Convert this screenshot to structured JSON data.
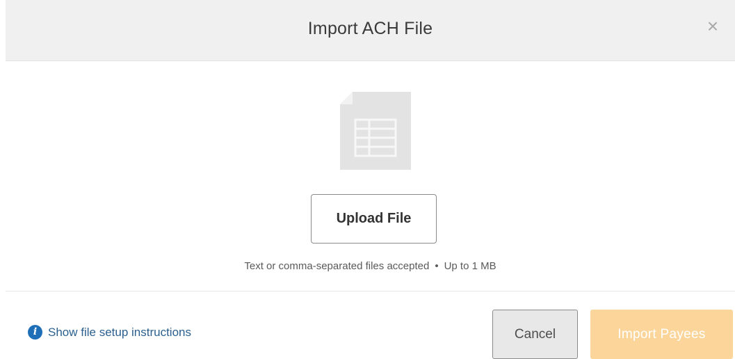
{
  "dialog": {
    "title": "Import ACH File",
    "close_icon": "close-icon",
    "close_glyph": "×"
  },
  "upload": {
    "icon": "spreadsheet-file-icon",
    "button_label": "Upload File",
    "hint_types": "Text or comma-separated files accepted",
    "hint_separator": "•",
    "hint_size": "Up to 1 MB"
  },
  "footer": {
    "info_icon": "info-icon",
    "info_glyph": "i",
    "instructions_link": "Show file setup instructions",
    "cancel_label": "Cancel",
    "import_label": "Import Payees",
    "import_disabled": true
  },
  "colors": {
    "header_bg": "#f0f0f0",
    "link": "#2a5f8e",
    "info_icon": "#1f6fb8",
    "import_disabled_bg": "#fbd59a"
  }
}
